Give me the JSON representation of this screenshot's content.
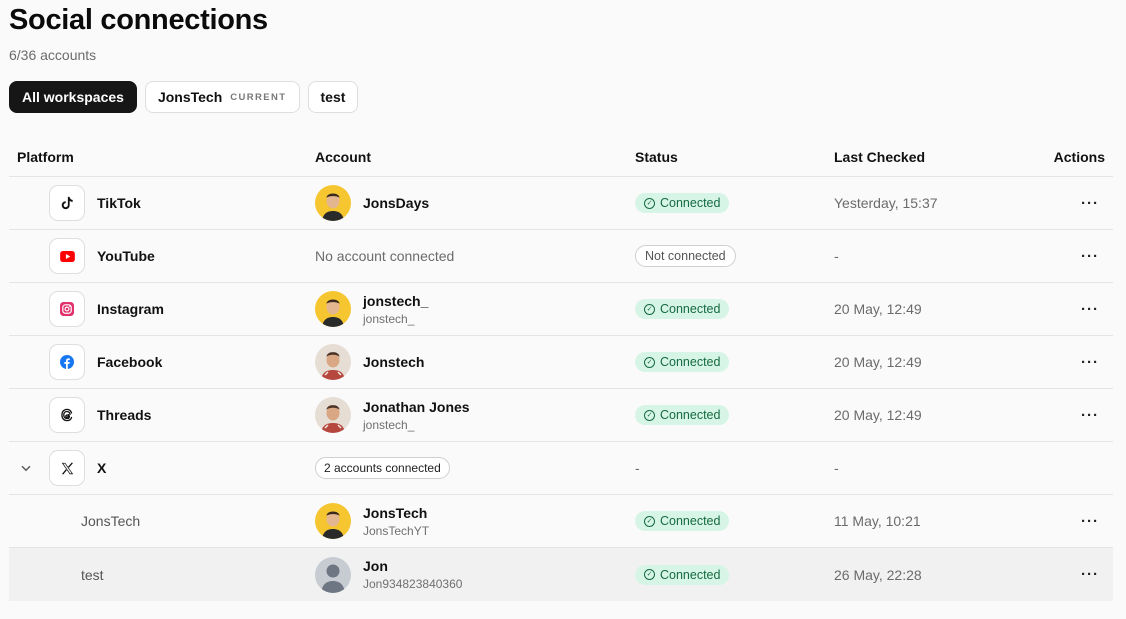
{
  "header": {
    "title": "Social connections",
    "subtitle": "6/36 accounts"
  },
  "tabs": [
    {
      "label": "All workspaces"
    },
    {
      "label": "JonsTech",
      "badge": "CURRENT"
    },
    {
      "label": "test"
    }
  ],
  "columns": {
    "platform": "Platform",
    "account": "Account",
    "status": "Status",
    "last_checked": "Last Checked",
    "actions": "Actions"
  },
  "rows": [
    {
      "platform": "TikTok",
      "account_name": "JonsDays",
      "status": "Connected",
      "last_checked": "Yesterday, 15:37",
      "actions": "···"
    },
    {
      "platform": "YouTube",
      "account_text": "No account connected",
      "status": "Not connected",
      "last_checked": "-",
      "actions": "···"
    },
    {
      "platform": "Instagram",
      "account_name": "jonstech_",
      "account_handle": "jonstech_",
      "status": "Connected",
      "last_checked": "20 May, 12:49",
      "actions": "···"
    },
    {
      "platform": "Facebook",
      "account_name": "Jonstech",
      "status": "Connected",
      "last_checked": "20 May, 12:49",
      "actions": "···"
    },
    {
      "platform": "Threads",
      "account_name": "Jonathan Jones",
      "account_handle": "jonstech_",
      "status": "Connected",
      "last_checked": "20 May, 12:49",
      "actions": "···"
    },
    {
      "platform": "X",
      "account_text": "2 accounts connected",
      "status": "-",
      "last_checked": "-"
    },
    {
      "workspace": "JonsTech",
      "account_name": "JonsTech",
      "account_handle": "JonsTechYT",
      "status": "Connected",
      "last_checked": "11 May, 10:21",
      "actions": "···"
    },
    {
      "workspace": "test",
      "account_name": "Jon",
      "account_handle": "Jon934823840360",
      "status": "Connected",
      "last_checked": "26 May, 22:28",
      "actions": "···"
    }
  ],
  "icons": {
    "tiktok": "tiktok-icon",
    "youtube": "youtube-icon",
    "instagram": "instagram-icon",
    "facebook": "facebook-icon",
    "threads": "threads-icon",
    "x": "x-icon",
    "expand": "chevron-down-icon",
    "check": "check-circle-icon",
    "more": "more-horizontal-icon"
  },
  "colors": {
    "connected_bg": "#d7f5e6",
    "connected_text": "#166a42",
    "active_tab": "#161616",
    "youtube": "#ff0000",
    "instagram": "#e1306c",
    "facebook": "#1877f2"
  }
}
